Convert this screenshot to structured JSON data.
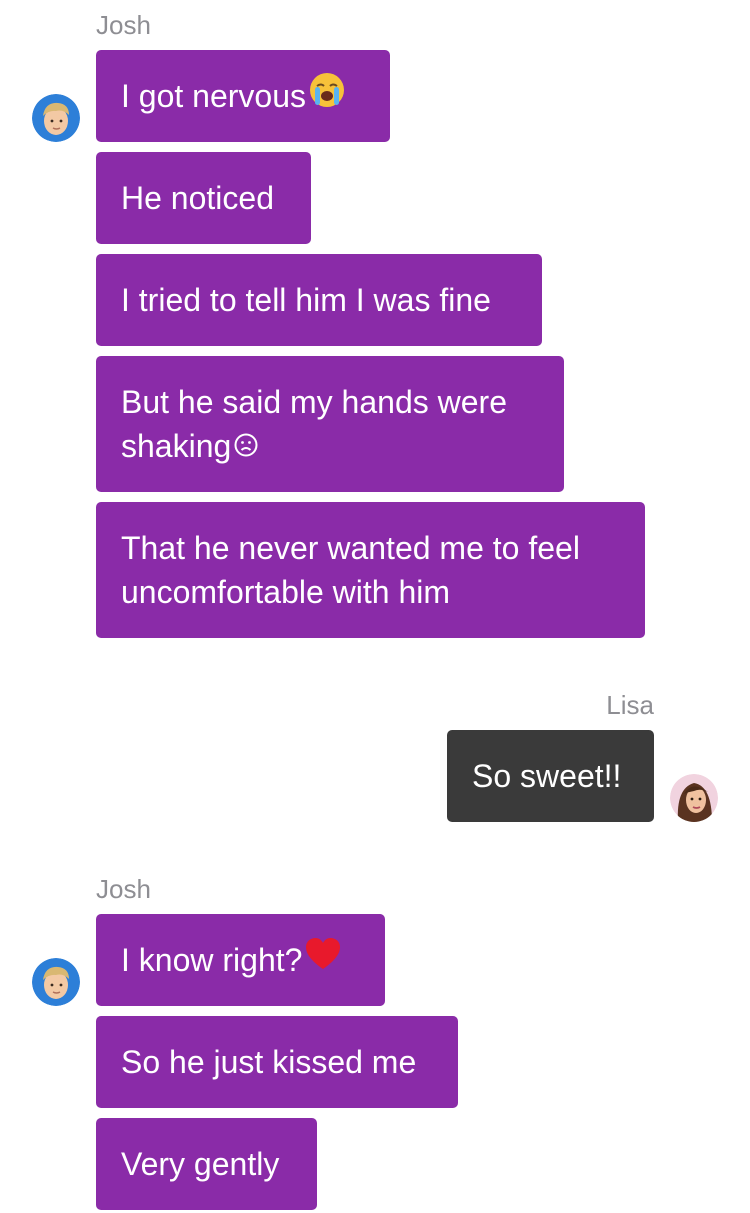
{
  "thread": {
    "group1": {
      "sender": "Josh",
      "messages": [
        "I got nervous",
        "He noticed",
        "I tried to tell him I was fine",
        "But he said my hands were",
        "shaking",
        "That he never wanted me to feel",
        "uncomfortable with him"
      ],
      "emoji": [
        "loudly-crying-face",
        "frowning-face"
      ]
    },
    "group2": {
      "sender": "Lisa",
      "messages": [
        "So sweet!!"
      ]
    },
    "group3": {
      "sender": "Josh",
      "messages": [
        "I know right?",
        "So he just kissed me",
        "Very gently"
      ],
      "emoji": [
        "red-heart"
      ]
    }
  },
  "colors": {
    "incoming_bubble": "#8a2ba8",
    "outgoing_bubble": "#3a3a3a",
    "sender_name": "#8e8e93"
  }
}
